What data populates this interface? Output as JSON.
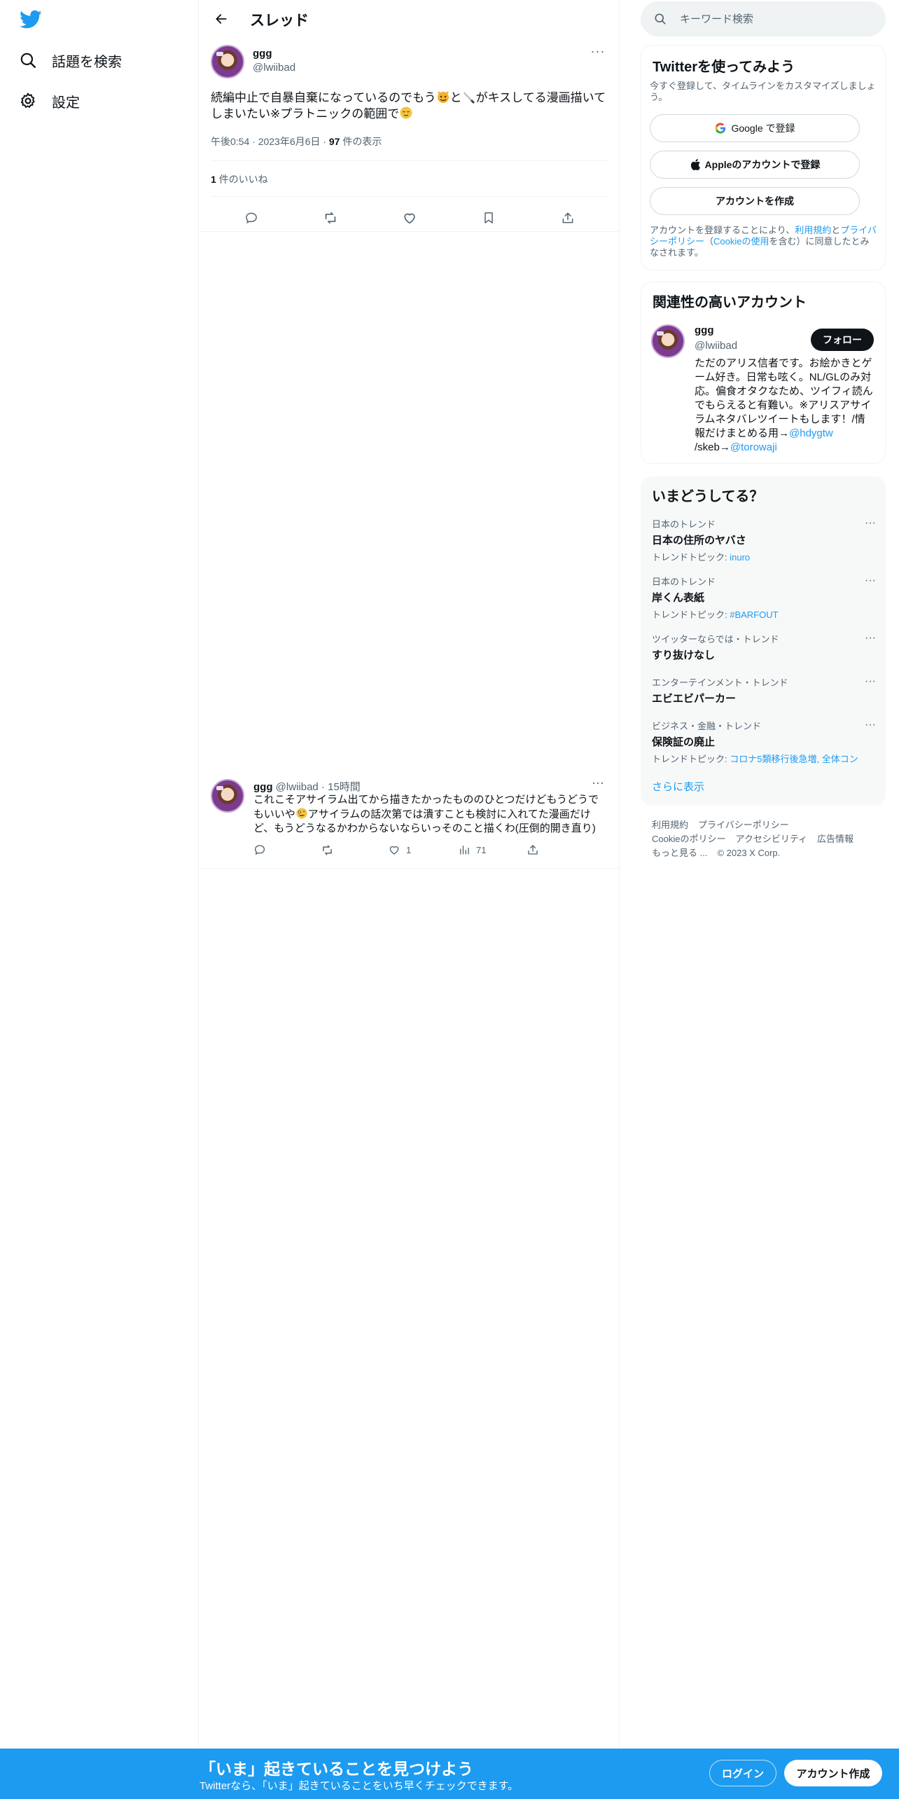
{
  "nav": {
    "logo": "twitter-bird-icon",
    "items": [
      {
        "label": "話題を検索",
        "icon": "search-icon"
      },
      {
        "label": "設定",
        "icon": "gear-icon"
      }
    ]
  },
  "header": {
    "title": "スレッド"
  },
  "main_tweet": {
    "name": "ggg",
    "handle": "@lwiibad",
    "text_part1": "続編中止で自暴自棄になっているのでもう",
    "text_part2": "と",
    "text_part3": "がキスしてる漫画描いてしまいたい※プラトニックの範囲で",
    "time": "午後0:54",
    "date": "2023年6月6日",
    "views_count": "97",
    "views_label": "件の表示",
    "likes_count": "1",
    "likes_label": "件のいいね"
  },
  "reply_tweet": {
    "name": "ggg",
    "handle": "@lwiibad",
    "time": "15時間",
    "text_part1": "これこそアサイラム出てから描きたかったもののひとつだけどもうどうでもいいや",
    "text_part2": "アサイラムの話次第では潰すことも検討に入れてた漫画だけど、もうどうなるかわからないならいっそのこと描くわ(圧倒的開き直り)",
    "likes": "1",
    "views": "71"
  },
  "search": {
    "placeholder": "キーワード検索"
  },
  "signup_card": {
    "title": "Twitterを使ってみよう",
    "subtitle": "今すぐ登録して、タイムラインをカスタマイズしましょう。",
    "google_btn": "Google で登録",
    "apple_btn": "Appleのアカウントで登録",
    "create_btn": "アカウントを作成",
    "terms_1": "アカウントを登録することにより、",
    "terms_link1": "利用規約",
    "terms_2": "と",
    "terms_link2": "プライバシーポリシー",
    "terms_3": "（",
    "terms_link3": "Cookieの使用",
    "terms_4": "を含む）に同意したとみなされます。"
  },
  "related_card": {
    "title": "関連性の高いアカウント",
    "name": "ggg",
    "handle": "@lwiibad",
    "follow_btn": "フォロー",
    "bio_1": "ただのアリス信者です。お絵かきとゲーム好き。日常も呟く。NL/GLのみ対応。偏食オタクなため、ツイフィ読んでもらえると有難い。※アリスアサイラムネタバレツイートもします！/情報だけまとめる用→",
    "bio_link1": "@hdygtw",
    "bio_2": " /skeb→",
    "bio_link2": "@torowaji"
  },
  "trends_card": {
    "title": "いまどうしてる？",
    "items": [
      {
        "context": "日本のトレンド",
        "title": "日本の住所のヤバさ",
        "sub_label": "トレンドトピック: ",
        "sub_link": "inuro"
      },
      {
        "context": "日本のトレンド",
        "title": "岸くん表紙",
        "sub_label": "トレンドトピック: ",
        "sub_link": "#BARFOUT"
      },
      {
        "context": "ツイッターならでは・トレンド",
        "title": "すり抜けなし",
        "sub_label": "",
        "sub_link": ""
      },
      {
        "context": "エンターテインメント・トレンド",
        "title": "エビエビパーカー",
        "sub_label": "",
        "sub_link": ""
      },
      {
        "context": "ビジネス・金融・トレンド",
        "title": "保険証の廃止",
        "sub_label": "トレンドトピック: ",
        "sub_link": "コロナ5類移行後急増, 全体コン"
      }
    ],
    "show_more": "さらに表示"
  },
  "footer": {
    "links": [
      "利用規約",
      "プライバシーポリシー",
      "Cookieのポリシー",
      "アクセシビリティ",
      "広告情報",
      "もっと見る ..."
    ],
    "copyright": "© 2023 X Corp."
  },
  "bottom_bar": {
    "title": "「いま」起きていることを見つけよう",
    "subtitle": "Twitterなら、「いま」起きていることをいち早くチェックできます。",
    "login_btn": "ログイン",
    "signup_btn": "アカウント作成"
  },
  "colors": {
    "accent": "#1d9bf0",
    "text": "#0f1419",
    "muted": "#536471",
    "border": "#eff3f4"
  }
}
